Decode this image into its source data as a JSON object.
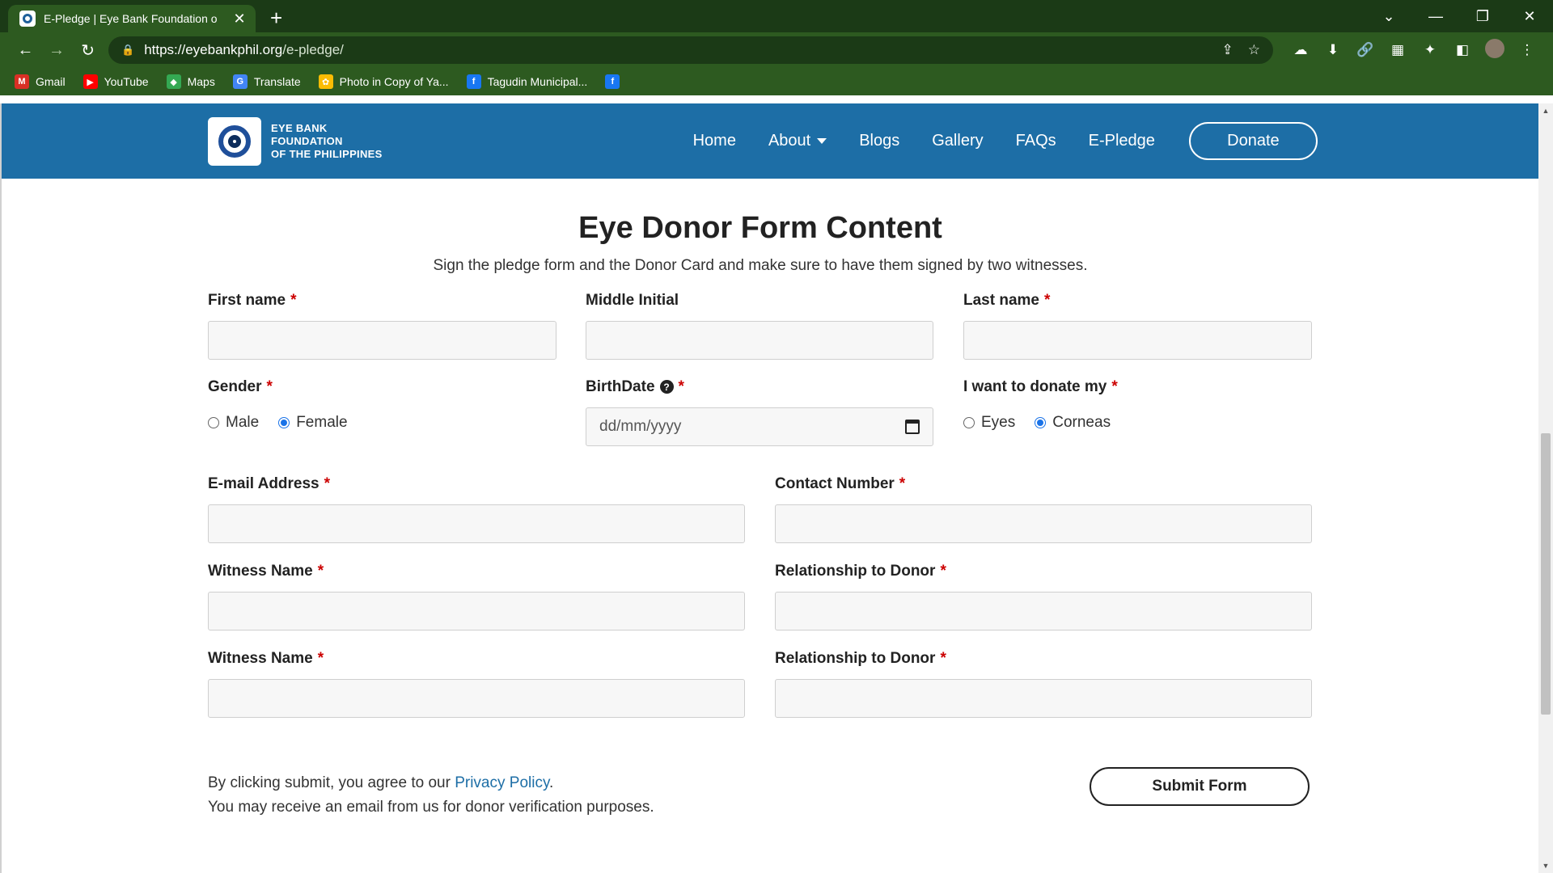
{
  "browser": {
    "tab_title": "E-Pledge | Eye Bank Foundation o",
    "tab_close": "✕",
    "new_tab": "+",
    "url_host": "https://eyebankphil.org",
    "url_path": "/e-pledge/",
    "window_controls": [
      "⌄",
      "—",
      "❐",
      "✕"
    ],
    "bookmarks": [
      {
        "label": "Gmail",
        "icon": "gmail-icon",
        "color": "#d93025",
        "glyph": "M"
      },
      {
        "label": "YouTube",
        "icon": "youtube-icon",
        "color": "#ff0000",
        "glyph": "▶"
      },
      {
        "label": "Maps",
        "icon": "maps-icon",
        "color": "#34a853",
        "glyph": "◆"
      },
      {
        "label": "Translate",
        "icon": "translate-icon",
        "color": "#4285f4",
        "glyph": "G"
      },
      {
        "label": "Photo in Copy of Ya...",
        "icon": "photos-icon",
        "color": "#fbbc04",
        "glyph": "✿"
      },
      {
        "label": "Tagudin Municipal...",
        "icon": "facebook-icon",
        "color": "#1877f2",
        "glyph": "f"
      },
      {
        "label": "",
        "icon": "facebook-icon",
        "color": "#1877f2",
        "glyph": "f"
      }
    ]
  },
  "site": {
    "logo_lines": [
      "EYE BANK",
      "FOUNDATION",
      "OF THE PHILIPPINES"
    ],
    "nav": [
      "Home",
      "About",
      "Blogs",
      "Gallery",
      "FAQs",
      "E-Pledge"
    ],
    "donate": "Donate",
    "brand_color": "#1d6ea6"
  },
  "form": {
    "title": "Eye Donor Form Content",
    "subtitle": "Sign the pledge form and the Donor Card and make sure to have them signed by two witnesses.",
    "required_mark": "*",
    "first_name": {
      "label": "First name",
      "value": ""
    },
    "middle_initial": {
      "label": "Middle Initial",
      "value": ""
    },
    "last_name": {
      "label": "Last name",
      "value": ""
    },
    "gender": {
      "label": "Gender",
      "options": [
        "Male",
        "Female"
      ],
      "selected": "Female"
    },
    "birthdate": {
      "label": "BirthDate",
      "placeholder": "dd/mm/yyyy",
      "help": "?"
    },
    "donate_my": {
      "label": "I want to donate my",
      "options": [
        "Eyes",
        "Corneas"
      ],
      "selected": "Corneas"
    },
    "email": {
      "label": "E-mail Address",
      "value": ""
    },
    "contact": {
      "label": "Contact Number",
      "value": ""
    },
    "witness1": {
      "label": "Witness Name",
      "value": ""
    },
    "relationship1": {
      "label": "Relationship to Donor",
      "value": ""
    },
    "witness2": {
      "label": "Witness Name",
      "value": ""
    },
    "relationship2": {
      "label": "Relationship to Donor",
      "value": ""
    },
    "agree_prefix": "By clicking submit, you agree to our ",
    "privacy_link": "Privacy Policy",
    "agree_suffix": ".",
    "verification_note": "You may receive an email from us for donor verification purposes.",
    "submit": "Submit Form"
  }
}
